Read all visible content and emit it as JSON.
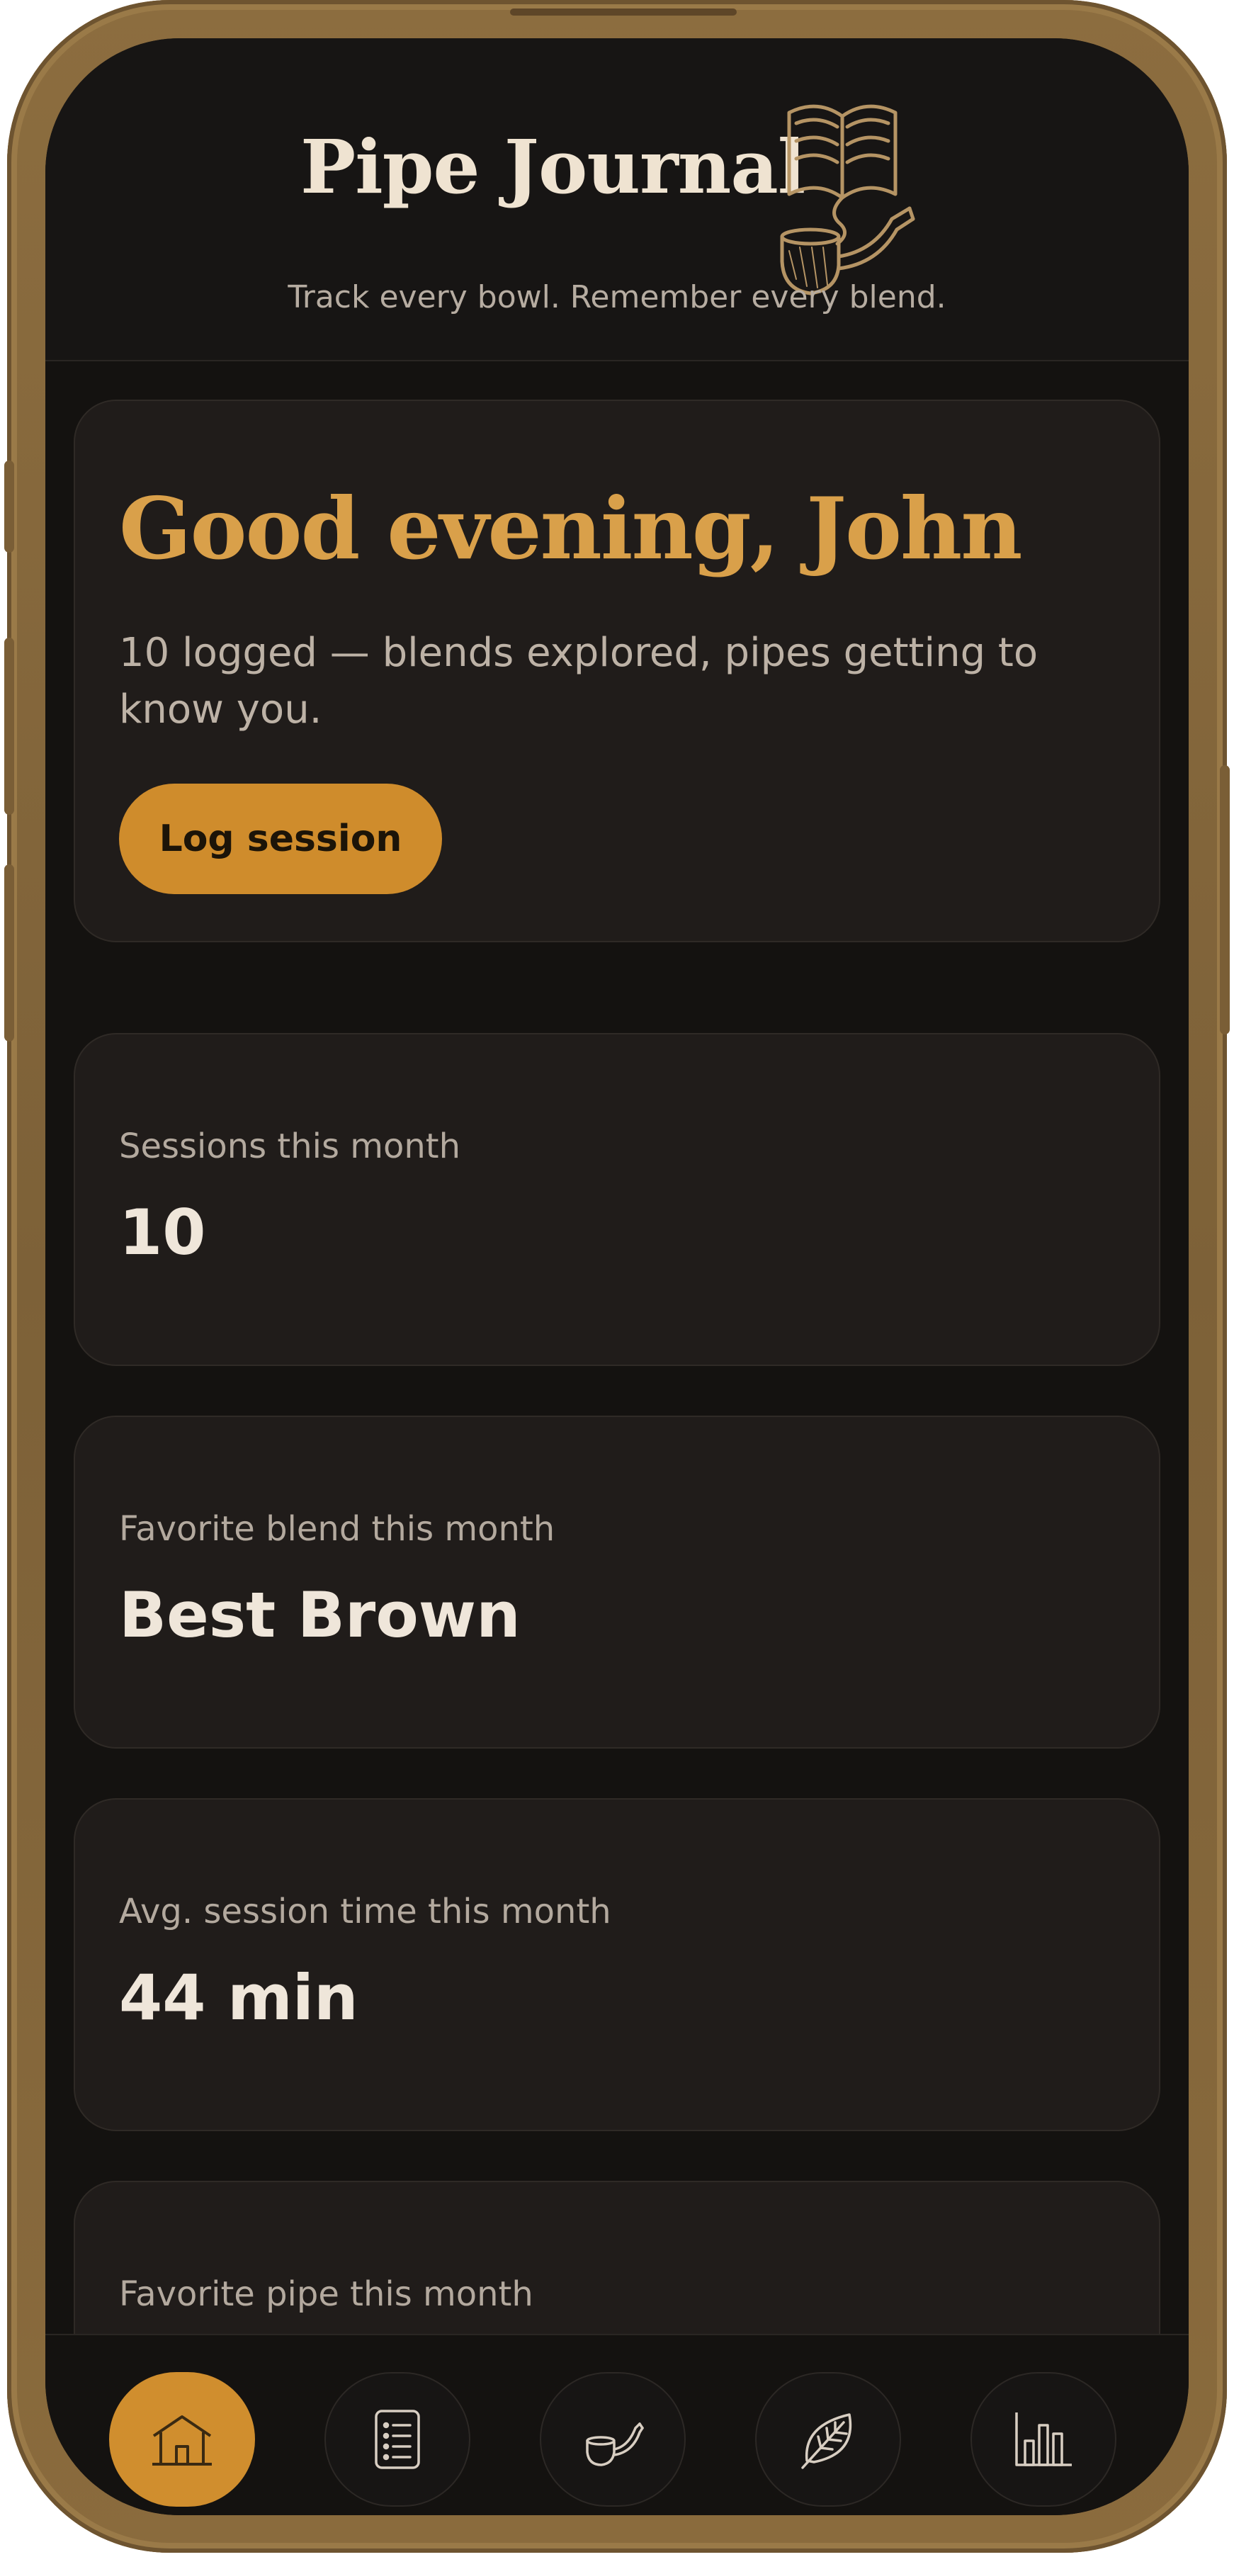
{
  "app": {
    "title": "Pipe Journal",
    "subtitle": "Track every bowl. Remember every blend.",
    "logo_icon": "book-and-pipe-icon"
  },
  "greeting_card": {
    "greeting": "Good evening, John",
    "text": "10 logged — blends explored, pipes getting to know you.",
    "button_label": "Log session"
  },
  "stats": [
    {
      "label": "Sessions this month",
      "value": "10"
    },
    {
      "label": "Favorite blend this month",
      "value": "Best Brown"
    },
    {
      "label": "Avg. session time this month",
      "value": "44 min"
    },
    {
      "label": "Favorite pipe this month",
      "value": ""
    }
  ],
  "nav": {
    "items": [
      {
        "icon": "home-icon",
        "active": true
      },
      {
        "icon": "list-icon",
        "active": false
      },
      {
        "icon": "pipe-icon",
        "active": false
      },
      {
        "icon": "leaf-icon",
        "active": false
      },
      {
        "icon": "bar-chart-icon",
        "active": false
      }
    ]
  },
  "colors": {
    "accent": "#cf8c2c",
    "greeting": "#d9a04a",
    "background": "#141210",
    "card": "#201c1a",
    "frame": "#8c6d3f"
  }
}
